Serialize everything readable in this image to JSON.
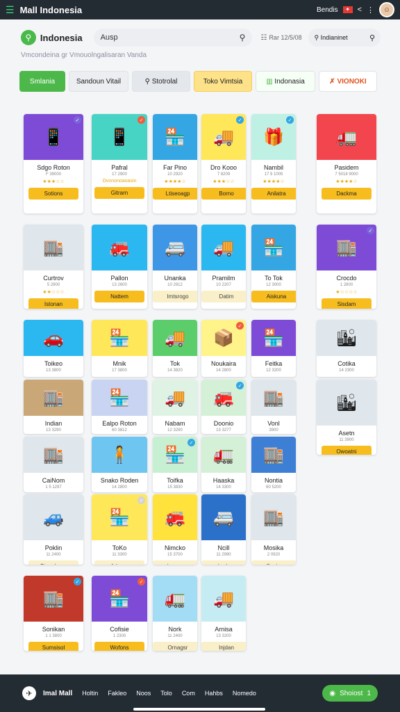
{
  "topbar": {
    "title": "Mall Indonesia",
    "right_label": "Bendis",
    "menu_icon": "menu-icon",
    "share_icon": "share-icon",
    "more_icon": "more-vertical-icon"
  },
  "search": {
    "brand": "Indonesia",
    "query": "Ausp",
    "date": "Rar 12/5/08",
    "secondary_query": "Indianinet"
  },
  "subtitle": "Vmcondeina gr Vmouolngalisaran Vanda",
  "chips": [
    "Smlania",
    "Sandoun Vitail",
    "Stotrolal",
    "Toko Vimtsia",
    "Indonasia",
    "VIONOKI"
  ],
  "cards": [
    {
      "name": "Sdgo Roton",
      "price": "F 39000",
      "stars": "★★★☆☆",
      "button": "Sotions",
      "bg": "#7d4bd6",
      "emoji": "📱",
      "badge": "#7b63d9",
      "style": "yellow"
    },
    {
      "name": "Pafral",
      "price": "17 2900",
      "stars": "Ovnnonoaoasin",
      "button": "Gitrarn",
      "bg": "#47d4c4",
      "emoji": "📱",
      "badge": "#f25c3c",
      "style": "yellow"
    },
    {
      "name": "Far Pino",
      "price": "10 2920",
      "stars": "★★★★☆",
      "button": "Ltiseoagp",
      "bg": "#33a6e3",
      "emoji": "🏪",
      "badge": "",
      "style": "yellow"
    },
    {
      "name": "Dro Kooo",
      "price": "7 8209",
      "stars": "★★★☆☆",
      "button": "Borno",
      "bg": "#ffe75a",
      "emoji": "🚚",
      "badge": "#33a6e3",
      "style": "yellow"
    },
    {
      "name": "Nambil",
      "price": "17 9 1005",
      "stars": "★★★★☆",
      "button": "Anilatra",
      "bg": "#bff0e4",
      "emoji": "🎁",
      "badge": "#33a6e3",
      "style": "yellow"
    },
    {
      "name": "Pasidem",
      "price": "7 5018 9000",
      "stars": "★★★★☆",
      "button": "Dackma",
      "bg": "#f2454d",
      "emoji": "🚛",
      "badge": "",
      "style": "yellow"
    },
    {
      "name": "Curtrov",
      "price": "5 2900",
      "stars": "★★☆☆☆",
      "button": "Istonan",
      "bg": "#dfe6ec",
      "emoji": "🏬",
      "badge": "",
      "style": "yellow"
    },
    {
      "name": "Pallon",
      "price": "13 2600",
      "stars": "",
      "button": "Nattem",
      "bg": "#2bb7f0",
      "emoji": "🚒",
      "badge": "",
      "style": "yellow"
    },
    {
      "name": "Unanka",
      "price": "10 2912",
      "stars": "",
      "button": "Imtsrogo",
      "bg": "#3e97e6",
      "emoji": "🚐",
      "badge": "",
      "style": "pale"
    },
    {
      "name": "Pramilm",
      "price": "10 2207",
      "stars": "",
      "button": "Datim",
      "bg": "#2bb7f0",
      "emoji": "🚚",
      "badge": "",
      "style": "pale"
    },
    {
      "name": "To Tok",
      "price": "12 3000",
      "stars": "",
      "button": "Aiskuna",
      "bg": "#33a6e3",
      "emoji": "🏪",
      "badge": "",
      "style": "yellow"
    },
    {
      "name": "Crocdo",
      "price": "1 2800",
      "stars": "★☆☆☆☆",
      "button": "Sisdam",
      "bg": "#7d4bd6",
      "emoji": "🏬",
      "badge": "#7b63d9",
      "style": "yellow"
    },
    {
      "name": "Toikeo",
      "price": "13 3800",
      "stars": "",
      "button": "",
      "bg": "#2bb7f0",
      "emoji": "🚗",
      "badge": "",
      "style": "none"
    },
    {
      "name": "Mnik",
      "price": "17 3800",
      "stars": "",
      "button": "",
      "bg": "#ffe75a",
      "emoji": "🏪",
      "badge": "",
      "style": "none"
    },
    {
      "name": "Tok",
      "price": "14 3820",
      "stars": "",
      "button": "",
      "bg": "#5ccd6b",
      "emoji": "🚚",
      "badge": "",
      "style": "none"
    },
    {
      "name": "Noukaira",
      "price": "14 2800",
      "stars": "",
      "button": "",
      "bg": "#fff48a",
      "emoji": "📦",
      "badge": "#f25c3c",
      "style": "none"
    },
    {
      "name": "Feitka",
      "price": "12 3200",
      "stars": "",
      "button": "",
      "bg": "#7d4bd6",
      "emoji": "🏪",
      "badge": "",
      "style": "none"
    },
    {
      "name": "Cotika",
      "price": "14 2300",
      "stars": "",
      "button": "",
      "bg": "#dfe6ec",
      "emoji": "🏙",
      "badge": "",
      "style": "none"
    },
    {
      "name": "Indian",
      "price": "13 3290",
      "stars": "",
      "button": "",
      "bg": "#c9a777",
      "emoji": "🏬",
      "badge": "",
      "style": "none"
    },
    {
      "name": "Ealpo Roton",
      "price": "60 3812",
      "stars": "",
      "button": "",
      "bg": "#c9d3f2",
      "emoji": "🏪",
      "badge": "",
      "style": "none"
    },
    {
      "name": "Nabam",
      "price": "12 3290",
      "stars": "",
      "button": "",
      "bg": "#dff3e4",
      "emoji": "🚚",
      "badge": "",
      "style": "none"
    },
    {
      "name": "Doonio",
      "price": "13 3277",
      "stars": "",
      "button": "",
      "bg": "#d4f1d8",
      "emoji": "🚒",
      "badge": "#33a6e3",
      "style": "none"
    },
    {
      "name": "Vonl",
      "price": "3900",
      "stars": "",
      "button": "",
      "bg": "#dfe6ec",
      "emoji": "🏬",
      "badge": "",
      "style": "none"
    },
    {
      "name": "Asetn",
      "price": "11 3900",
      "stars": "",
      "button": "Owoatni",
      "bg": "#dfe6ec",
      "emoji": "🏙",
      "badge": "",
      "style": "yellow"
    },
    {
      "name": "CaiNom",
      "price": "1 5 1297",
      "stars": "",
      "button": "",
      "bg": "#dfe6ec",
      "emoji": "🏬",
      "badge": "",
      "style": "none"
    },
    {
      "name": "Snako Roden",
      "price": "14 2800",
      "stars": "",
      "button": "",
      "bg": "#6ec5ef",
      "emoji": "🧍",
      "badge": "",
      "style": "none"
    },
    {
      "name": "Toifka",
      "price": "15 3830",
      "stars": "",
      "button": "",
      "bg": "#c7f0d2",
      "emoji": "🏪",
      "badge": "#33a6e3",
      "style": "none"
    },
    {
      "name": "Haaska",
      "price": "14 3300",
      "stars": "",
      "button": "",
      "bg": "#d4f1d8",
      "emoji": "🚛",
      "badge": "",
      "style": "none"
    },
    {
      "name": "Nontia",
      "price": "60 5200",
      "stars": "",
      "button": "",
      "bg": "#3e7fd6",
      "emoji": "🏬",
      "badge": "",
      "style": "none"
    },
    {
      "name": "Poklin",
      "price": "11 2400",
      "stars": "",
      "button": "Ptesulsger",
      "bg": "#dfe6ec",
      "emoji": "🚙",
      "badge": "",
      "style": "pale"
    },
    {
      "name": "ToKo",
      "price": "11 3300",
      "stars": "",
      "button": "Adarno",
      "bg": "#ffe75a",
      "emoji": "🏪",
      "badge": "#d4d4d4",
      "style": "pale"
    },
    {
      "name": "Nimcko",
      "price": "15 3700",
      "stars": "",
      "button": "Imagens",
      "bg": "#ffe23b",
      "emoji": "🚒",
      "badge": "",
      "style": "pale"
    },
    {
      "name": "Ncill",
      "price": "11 2990",
      "stars": "",
      "button": "Isrdem",
      "bg": "#2c71c9",
      "emoji": "🚐",
      "badge": "",
      "style": "pale"
    },
    {
      "name": "Mosika",
      "price": "2 0920",
      "stars": "",
      "button": "Sonisen",
      "bg": "#dfe6ec",
      "emoji": "🏬",
      "badge": "",
      "style": "pale"
    },
    {
      "name": "Sonikan",
      "price": "1 1 3800",
      "stars": "",
      "button": "Sumsisol",
      "bg": "#c0392b",
      "emoji": "🏬",
      "badge": "#33a6e3",
      "style": "yellow"
    },
    {
      "name": "Cofisie",
      "price": "1 2300",
      "stars": "",
      "button": "Wofons",
      "bg": "#7d4bd6",
      "emoji": "🏪",
      "badge": "#f25c3c",
      "style": "yellow"
    },
    {
      "name": "Nork",
      "price": "11 2400",
      "stars": "",
      "button": "Ornagsr",
      "bg": "#a3ddf5",
      "emoji": "🚛",
      "badge": "",
      "style": "pale"
    },
    {
      "name": "Arnisa",
      "price": "13 3200",
      "stars": "",
      "button": "Injdan",
      "bg": "#c6ecf3",
      "emoji": "🚚",
      "badge": "",
      "style": "pale"
    }
  ],
  "bottombar": {
    "brand": "Imal Mall",
    "nav": [
      "Holtin",
      "Fakleo",
      "Noos",
      "Tolo",
      "Com",
      "Hahbs",
      "Nomedo"
    ],
    "cta_label": "Shoiost",
    "cta_count": "1"
  }
}
